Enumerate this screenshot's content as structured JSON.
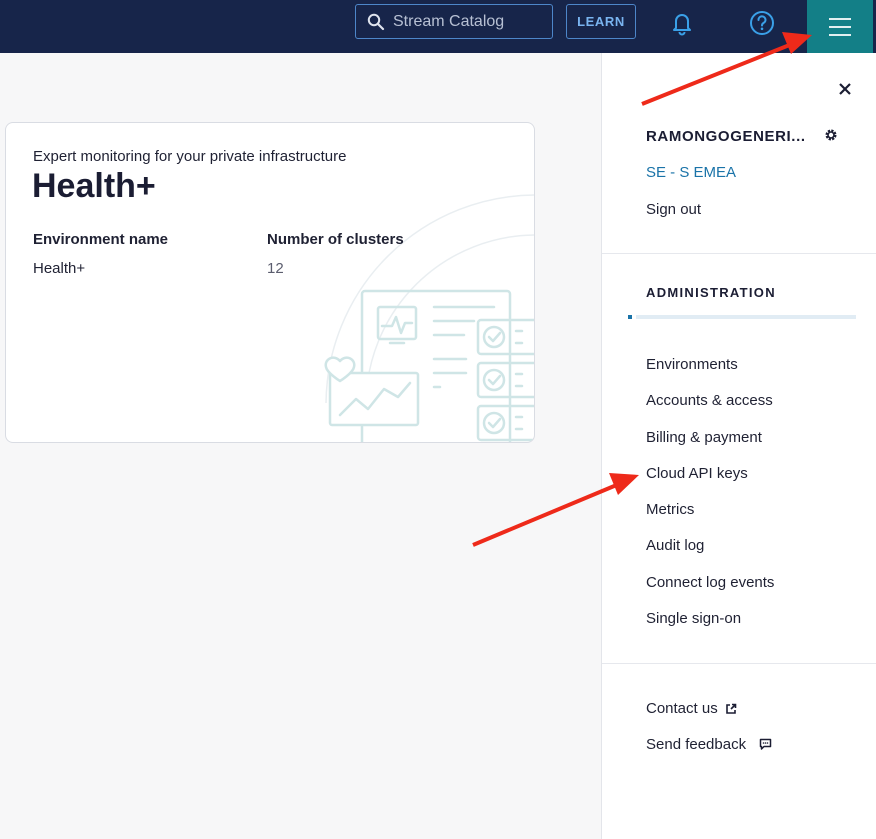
{
  "topbar": {
    "search_placeholder": "Stream Catalog",
    "learn_label": "LEARN",
    "icons": [
      "search-icon",
      "bell-icon",
      "help-icon",
      "menu-icon"
    ]
  },
  "card": {
    "subtitle": "Expert monitoring for your private infrastructure",
    "title": "Health+",
    "columns": [
      "Environment name",
      "Number of clusters"
    ],
    "values": [
      "Health+",
      "12"
    ]
  },
  "panel": {
    "user_name": "RAMONGOGENERI...",
    "org_name": "SE - S EMEA",
    "sign_out": "Sign out",
    "admin_heading": "ADMINISTRATION",
    "admin_items": [
      "Environments",
      "Accounts & access",
      "Billing & payment",
      "Cloud API keys",
      "Metrics",
      "Audit log",
      "Connect log events",
      "Single sign-on"
    ],
    "contact_us": "Contact us",
    "send_feedback": "Send feedback"
  },
  "colors": {
    "topbar_bg": "#17254a",
    "menu_button_bg": "#137f87",
    "link_blue": "#1a73a8",
    "annotation_arrow": "#ee2a1a"
  }
}
